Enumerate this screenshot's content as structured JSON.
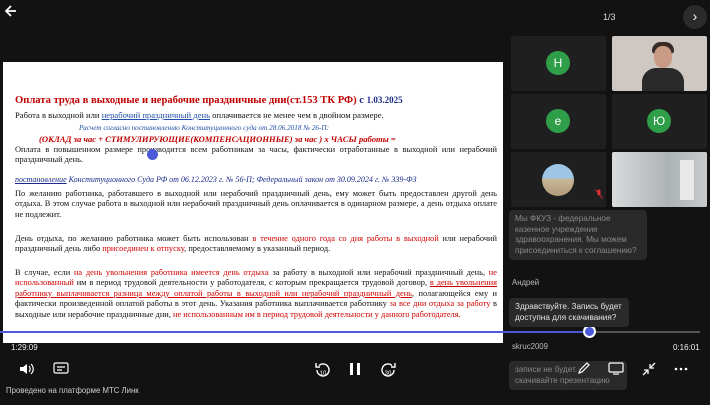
{
  "player": {
    "back_icon": "back-arrow-icon",
    "page_counter": "1/3",
    "next_icon": "chevron-right-icon",
    "time_elapsed": "1:29:09",
    "time_remaining": "0:16:01",
    "progress_fraction": 0.42,
    "footer": "Проведено на платформе МТС Линк"
  },
  "slide": {
    "title": "Оплата труда в выходные и нерабочие праздничные дни(ст.153 ТК РФ)",
    "title_suffix": " с ",
    "title_date": "1.03.2025",
    "line2_a": "Работа в выходной или ",
    "line2_link": "нерабочий праздничный день",
    "line2_b": " оплачивается не менее чем в двойном размере.",
    "line3": "Расчет согласно постановлению Конституционного суда от 28.06.2018 № 26-П:",
    "line4": "(ОКЛАД за час + СТИМУЛИРУЮЩИЕ(КОМПЕНСАЦИОННЫЕ) за час ) х ЧАСЫ работы =",
    "para1": "Оплата в повышенном размере производится всем работникам за часы, фактически отработанные в выходной или нерабочий праздничный день.",
    "para2_link": "постановление",
    "para2_rest": " Конституционного Суда РФ от 06.12.2023 г. № 56-П;  Федеральный закон от 30.09.2024 г. № 339-ФЗ",
    "para3": "По желанию работника, работавшего в выходной или нерабочий праздничный день, ему может быть предоставлен другой день отдыха. В этом случае работа в выходной или нерабочий праздничный день оплачивается в одинарном размере, а день отдыха оплате не подлежит.",
    "para4_a": "День отдыха, по желанию работника может быть использован ",
    "para4_red1": "в течение одного года со дня работы в выходной",
    "para4_b": " или нерабочий праздничный день либо ",
    "para4_red2": "присоединен к отпуску",
    "para4_c": ", предоставляемому в указанный период.",
    "para5_a": "В случае, если ",
    "para5_red1": "на день увольнения работника имеется день отдыха",
    "para5_b": " за работу в выходной или нерабочий праздничный день, ",
    "para5_red2": "не использованный",
    "para5_c": " им в период трудовой деятельности у работодателя, с которым прекращается трудовой договор, ",
    "para5_red3": "в день увольнения работнику выплачивается разница между оплатой работы в выходной или нерабочий праздничный день",
    "para5_d": ", полагающейся ему и фактически произведенной оплатой работы в этот день. Указания работника выплачивается работнику ",
    "para5_red4": "за все дни отдыха за работу",
    "para5_e": " в выходные или нерабочие праздничные дни, ",
    "para5_red5": "не использованным им в период трудовой деятельности у данного работодателя."
  },
  "participants": [
    {
      "initial": "Н",
      "type": "avatar",
      "color": "#2e9e48"
    },
    {
      "type": "camera",
      "label": "woman-camera"
    },
    {
      "initial": "е",
      "type": "avatar",
      "color": "#2e9e48"
    },
    {
      "initial": "Ю",
      "type": "avatar",
      "color": "#2e9e48"
    },
    {
      "type": "building-avatar",
      "muted_icon": "mic-off-icon"
    },
    {
      "type": "camera",
      "label": "room-camera"
    }
  ],
  "chat": {
    "message1": "Мы ФКУЗ - федеральное казенное учреждение здравоохранения. Мы можем присоединиться к соглашению?",
    "author2": "Андрей",
    "message2": "Здравствуйте. Запись будет доступна для скачивания?",
    "author3": "skruc2009",
    "message3": "записи не будет. скачивайте презентацию"
  },
  "controls": {
    "volume_icon": "volume-icon",
    "subtitles_icon": "subtitles-icon",
    "rewind_label": "10",
    "pause_icon": "pause-icon",
    "forward_label": "30",
    "draw_icon": "pencil-icon",
    "screen_icon": "screen-icon",
    "collapse_icon": "collapse-icon",
    "more_icon": "more-icon"
  },
  "colors": {
    "accent": "#4a5ad8",
    "avatar_green": "#2e9e48",
    "slide_red": "#c00000"
  }
}
